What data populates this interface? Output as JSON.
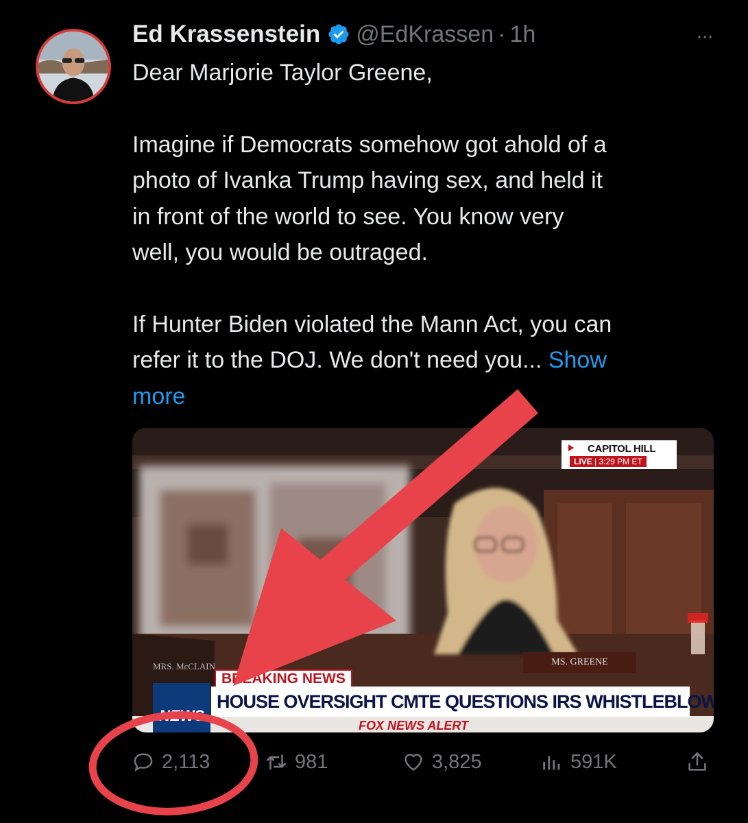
{
  "tweet": {
    "author_name": "Ed Krassenstein",
    "handle": "@EdKrassen",
    "separator": "·",
    "time": "1h",
    "more_glyph": "···",
    "lines": [
      "Dear Marjorie Taylor Greene,",
      "",
      "Imagine if Democrats somehow got ahold of a",
      "photo of Ivanka Trump having sex, and held it",
      "in front of the world to see.  You know very",
      "well, you would be outraged.",
      "",
      "If Hunter Biden violated the Mann Act, you can",
      "refer it to the DOJ. We don't need you..."
    ],
    "show_more": "Show more",
    "show_more_line1": "Show",
    "show_more_line2": "more"
  },
  "media": {
    "location_label": "CAPITOL HILL",
    "live_label": "LIVE",
    "live_time": "| 3:29 PM ET",
    "nameplate_right": "MS. GREENE",
    "nameplate_left": "MRS. McCLAIN",
    "breaking_a": "BREAKING",
    "breaking_b": "NEWS",
    "headline": "HOUSE OVERSIGHT CMTE QUESTIONS IRS WHISTLEBLOWERS",
    "alert": "FOX NEWS ALERT",
    "logo_text": "NEWS"
  },
  "actions": {
    "replies": "2,113",
    "retweets": "981",
    "likes": "3,825",
    "views": "591K"
  },
  "icons": {
    "verified": "verified-badge-icon",
    "reply": "reply-icon",
    "retweet": "retweet-icon",
    "like": "heart-icon",
    "views": "views-icon",
    "share": "share-icon",
    "more": "more-icon"
  },
  "colors": {
    "background": "#000000",
    "text": "#e7e9ea",
    "muted": "#71767b",
    "link": "#1d9bf0",
    "annotation": "#e8424a"
  }
}
